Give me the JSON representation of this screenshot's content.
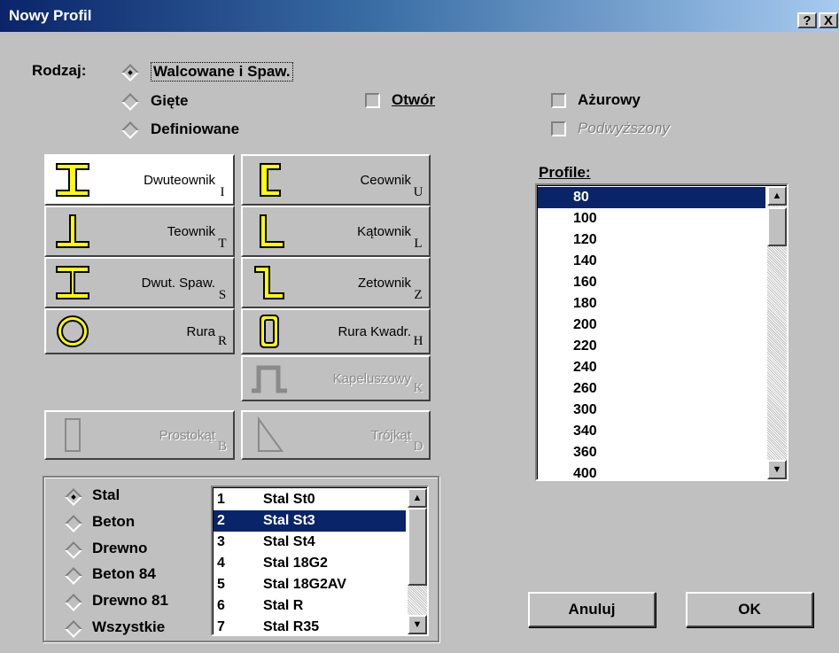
{
  "window": {
    "title": "Nowy Profil",
    "help_label": "?",
    "close_label": "X"
  },
  "kind": {
    "label": "Rodzaj:",
    "options": [
      {
        "label": "Walcowane i Spaw.",
        "selected": true
      },
      {
        "label": "Gięte",
        "selected": false
      },
      {
        "label": "Definiowane",
        "selected": false
      }
    ]
  },
  "checkboxes": {
    "otwor": {
      "label": "Otwór",
      "checked": false
    },
    "azurowy": {
      "label": "Ażurowy",
      "checked": false
    },
    "podwyzszony": {
      "label": "Podwyższony",
      "checked": false,
      "enabled": false
    }
  },
  "profile_types": [
    {
      "label": "Dwuteownik",
      "key": "I",
      "icon": "i-beam-icon",
      "selected": true
    },
    {
      "label": "Ceownik",
      "key": "U",
      "icon": "channel-icon"
    },
    {
      "label": "Teownik",
      "key": "T",
      "icon": "tee-icon"
    },
    {
      "label": "Kątownik",
      "key": "L",
      "icon": "angle-icon"
    },
    {
      "label": "Dwut. Spaw.",
      "key": "S",
      "icon": "welded-i-beam-icon"
    },
    {
      "label": "Zetownik",
      "key": "Z",
      "icon": "z-section-icon"
    },
    {
      "label": "Rura",
      "key": "R",
      "icon": "round-tube-icon"
    },
    {
      "label": "Rura Kwadr.",
      "key": "H",
      "icon": "square-tube-icon"
    },
    {
      "label": "Kapeluszowy",
      "key": "K",
      "icon": "hat-section-icon",
      "enabled": false
    },
    {
      "label": "Prostokąt",
      "key": "B",
      "icon": "rectangle-icon",
      "enabled": false
    },
    {
      "label": "Trójkąt",
      "key": "D",
      "icon": "triangle-icon",
      "enabled": false
    }
  ],
  "profiles": {
    "label": "Profile:",
    "items": [
      "80",
      "100",
      "120",
      "140",
      "160",
      "180",
      "200",
      "220",
      "240",
      "260",
      "300",
      "340",
      "360",
      "400"
    ],
    "selected_index": 0
  },
  "materials": {
    "radios": [
      {
        "label": "Stal",
        "selected": true
      },
      {
        "label": "Beton",
        "selected": false
      },
      {
        "label": "Drewno",
        "selected": false
      },
      {
        "label": "Beton 84",
        "selected": false
      },
      {
        "label": "Drewno 81",
        "selected": false
      },
      {
        "label": "Wszystkie",
        "selected": false
      }
    ],
    "grades": [
      {
        "num": "1",
        "name": "Stal St0"
      },
      {
        "num": "2",
        "name": "Stal St3"
      },
      {
        "num": "3",
        "name": "Stal St4"
      },
      {
        "num": "4",
        "name": "Stal 18G2"
      },
      {
        "num": "5",
        "name": "Stal 18G2AV"
      },
      {
        "num": "6",
        "name": "Stal R"
      },
      {
        "num": "7",
        "name": "Stal R35"
      }
    ],
    "selected_index": 1
  },
  "buttons": {
    "cancel": "Anuluj",
    "ok": "OK"
  },
  "colors": {
    "title_start": "#0a246a",
    "selection": "#0a246a",
    "icon_fill": "#ffff00",
    "face": "#c0c0c0"
  }
}
